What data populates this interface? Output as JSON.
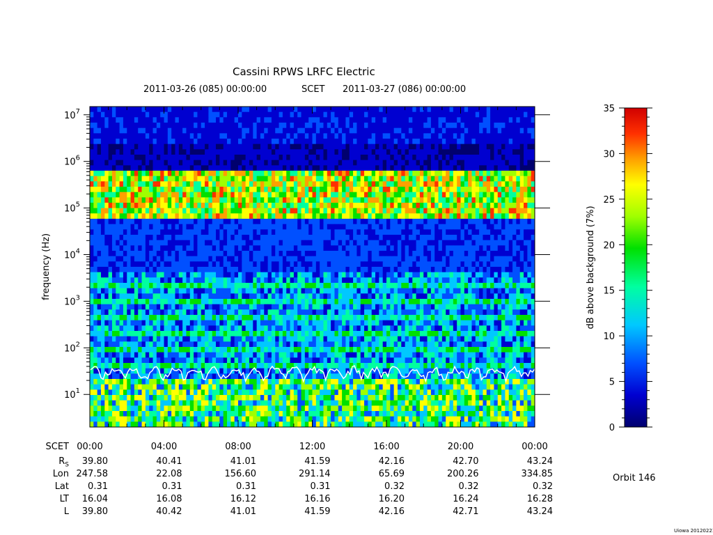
{
  "title": "Cassini RPWS LRFC Electric",
  "subtitle": {
    "start": "2011-03-26 (085) 00:00:00",
    "mid": "SCET",
    "end": "2011-03-27 (086) 00:00:00"
  },
  "orbit": "Orbit 146",
  "footer": "Uiowa 20120221",
  "colors": {
    "colormap": [
      "#00006e",
      "#0000d0",
      "#0050ff",
      "#00c8ff",
      "#00ffa0",
      "#00e000",
      "#a0ff00",
      "#ffff00",
      "#ffa000",
      "#ff3000",
      "#d00000"
    ],
    "trace": "#ffffff"
  },
  "chart_data": {
    "type": "heatmap",
    "title": "Cassini RPWS LRFC Electric",
    "xlabel": "SCET",
    "ylabel": "frequency (Hz)",
    "y_scale": "log",
    "ylim": [
      2,
      15000000
    ],
    "y_ticks": [
      {
        "base": "10",
        "exp": "1",
        "value": 10
      },
      {
        "base": "10",
        "exp": "2",
        "value": 100
      },
      {
        "base": "10",
        "exp": "3",
        "value": 1000
      },
      {
        "base": "10",
        "exp": "4",
        "value": 10000
      },
      {
        "base": "10",
        "exp": "5",
        "value": 100000
      },
      {
        "base": "10",
        "exp": "6",
        "value": 1000000
      },
      {
        "base": "10",
        "exp": "7",
        "value": 10000000
      }
    ],
    "x_range": [
      "2011-03-26T00:00:00",
      "2011-03-27T00:00:00"
    ],
    "x_ticks": [
      "00:00",
      "04:00",
      "08:00",
      "12:00",
      "16:00",
      "20:00",
      "00:00"
    ],
    "colorbar": {
      "label": "dB above background (7%)",
      "range": [
        0,
        35
      ],
      "ticks": [
        "0",
        "5",
        "10",
        "15",
        "20",
        "25",
        "30",
        "35"
      ]
    },
    "ephemeris": {
      "row_label": "SCET",
      "rows": [
        {
          "label": "R",
          "sub": "S",
          "values": [
            "39.80",
            "40.41",
            "41.01",
            "41.59",
            "42.16",
            "42.70",
            "43.24"
          ]
        },
        {
          "label": "Lon",
          "values": [
            "247.58",
            "22.08",
            "156.60",
            "291.14",
            "65.69",
            "200.26",
            "334.85"
          ]
        },
        {
          "label": "Lat",
          "values": [
            "0.31",
            "0.31",
            "0.31",
            "0.31",
            "0.32",
            "0.32",
            "0.32"
          ]
        },
        {
          "label": "LT",
          "values": [
            "16.04",
            "16.08",
            "16.12",
            "16.16",
            "16.20",
            "16.24",
            "16.28"
          ]
        },
        {
          "label": "L",
          "values": [
            "39.80",
            "40.42",
            "41.01",
            "41.59",
            "42.16",
            "42.71",
            "43.24"
          ]
        }
      ]
    }
  }
}
